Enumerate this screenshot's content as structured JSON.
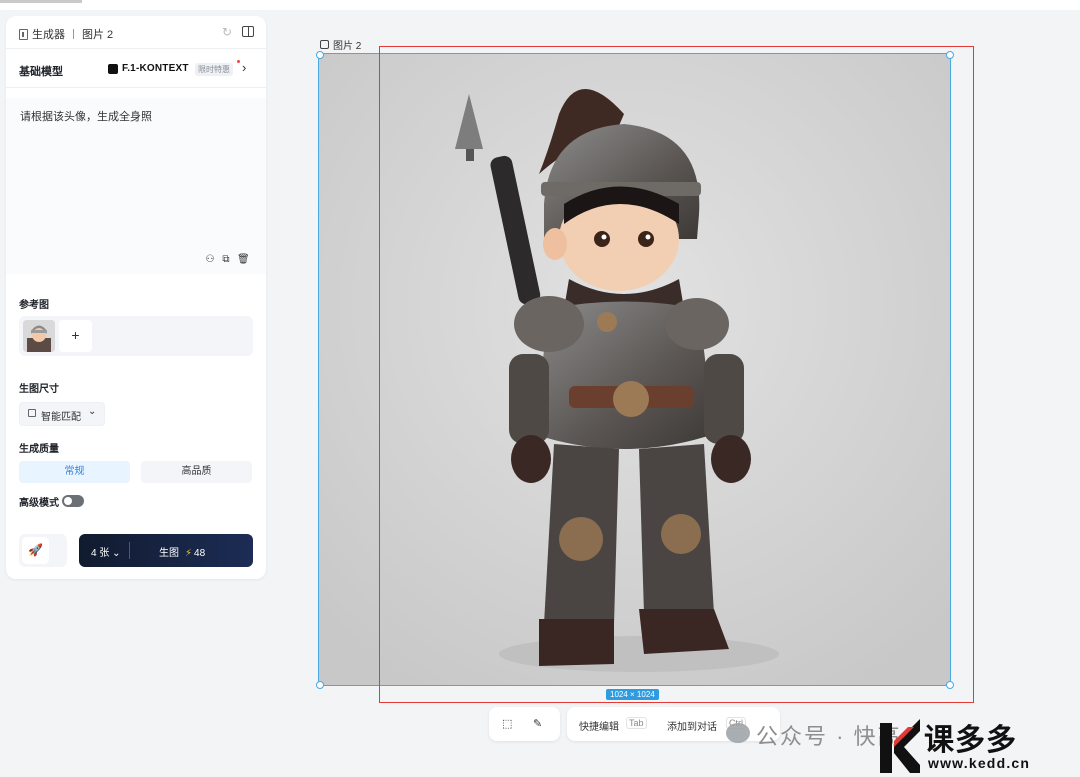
{
  "panel": {
    "header": {
      "app_name": "生成器",
      "tab_name": "图片 2"
    },
    "model": {
      "label": "基础模型",
      "name": "F.1-KONTEXT",
      "tag": "限时特惠"
    },
    "prompt": {
      "text": "请根据该头像，生成全身照"
    },
    "reference": {
      "title": "参考图",
      "add_symbol": "+"
    },
    "size": {
      "title": "生图尺寸",
      "value": "智能匹配"
    },
    "quality": {
      "title": "生成质量",
      "options": [
        "常规",
        "高品质"
      ],
      "selected": "常规"
    },
    "advanced": {
      "label": "高级模式",
      "enabled": false
    },
    "generate": {
      "count": "4 张",
      "label": "生图",
      "cost": "48"
    }
  },
  "canvas": {
    "image_label": "图片 2",
    "dimensions": "1024 × 1024"
  },
  "toolbar": {
    "quick_edit": "快捷编辑",
    "quick_edit_key": "Tab",
    "add_to_chat": "添加到对话",
    "add_to_chat_key": "Ctrl"
  },
  "watermark": {
    "channel": "公众号 · 快高",
    "brand": "课多多",
    "url": "www.kedd.cn"
  },
  "colors": {
    "accent_blue": "#3880d9",
    "selection_blue": "#4aa9e0",
    "highlight_red": "#e53935",
    "button_dark": "#111b2f",
    "bolt_yellow": "#f5c518"
  }
}
